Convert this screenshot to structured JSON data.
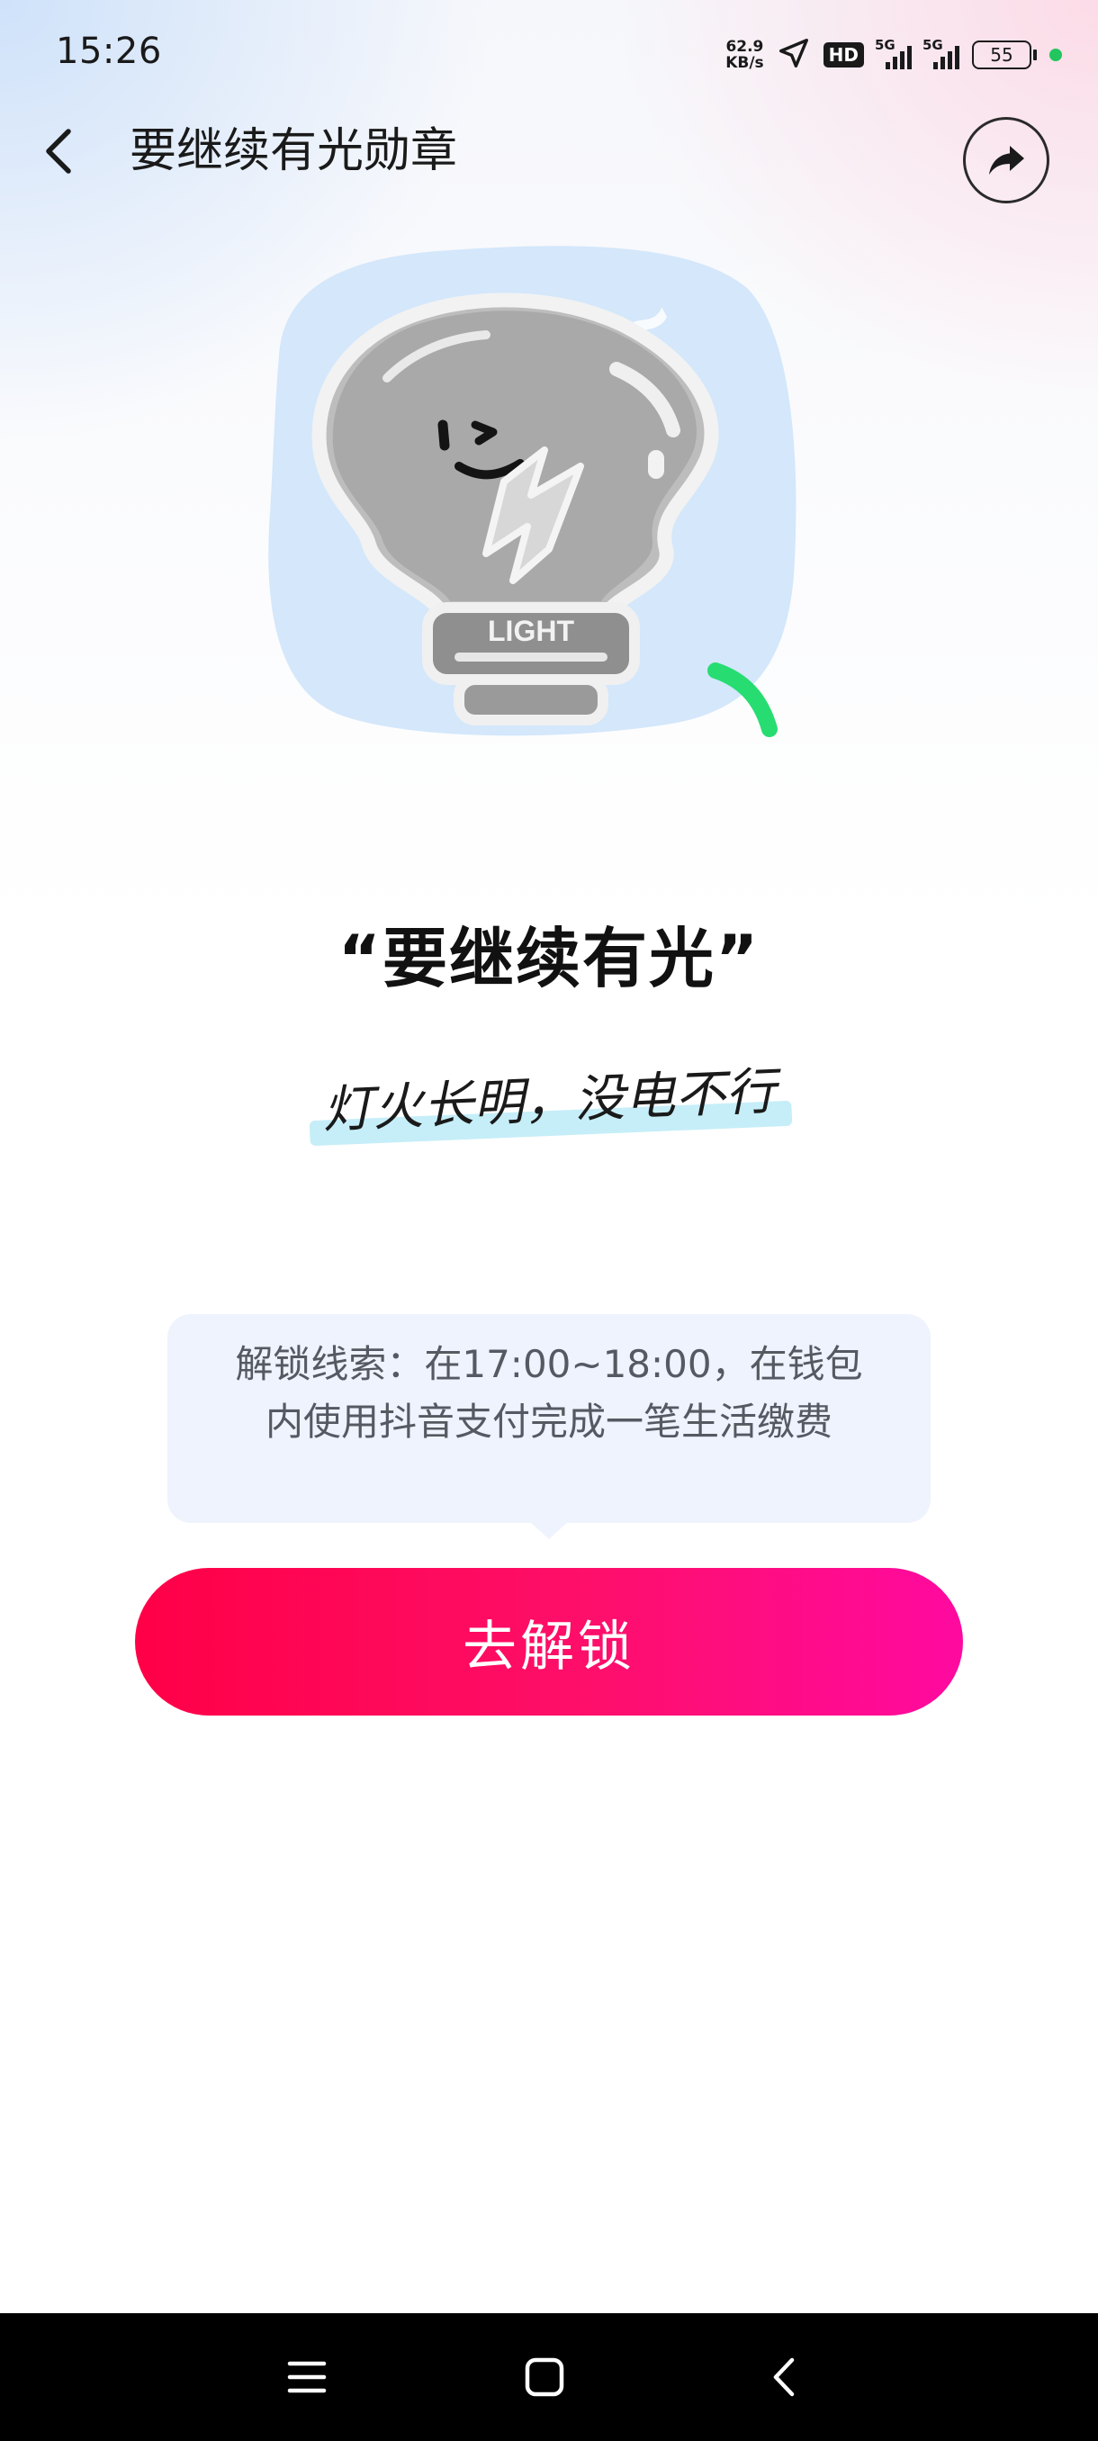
{
  "status_bar": {
    "time": "15:26",
    "net_speed_value": "62.9",
    "net_speed_unit": "KB/s",
    "hd_label": "HD",
    "signal1_label": "5G",
    "signal2_label": "5G",
    "battery_level": "55"
  },
  "header": {
    "title": "要继续有光勋章"
  },
  "badge": {
    "name": "“要继续有光”",
    "slogan": "灯火长明，没电不行"
  },
  "hint": {
    "text": "解锁线索：在17:00~18:00，在钱包内使用抖音支付完成一笔生活缴费"
  },
  "actions": {
    "unlock_label": "去解锁"
  },
  "colors": {
    "accent": "#fe2c55",
    "button_start": "#ff0047",
    "button_end": "#ff0aa0",
    "hint_bg": "#eef3fd",
    "battery_dot": "#22c55e"
  },
  "icons": {
    "back": "chevron-left-icon",
    "share": "share-icon",
    "nav_menu": "menu-icon",
    "nav_home": "home-icon",
    "nav_back": "back-icon"
  }
}
